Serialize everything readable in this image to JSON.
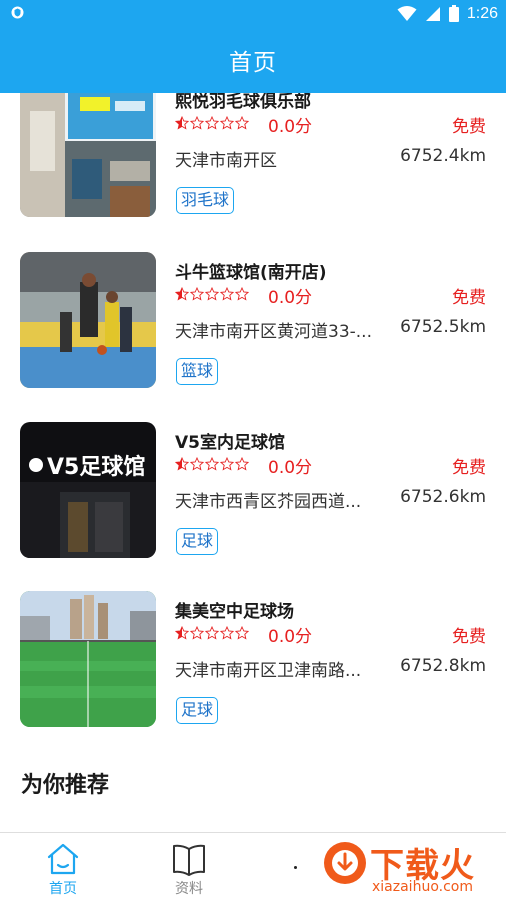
{
  "status_bar": {
    "time": "1:26"
  },
  "header": {
    "title": "首页"
  },
  "venues": [
    {
      "name": "熙悦羽毛球俱乐部",
      "rating": "0.0分",
      "stars_filled": 0.5,
      "price": "免费",
      "address": "天津市南开区",
      "distance": "6752.4km",
      "tag": "羽毛球"
    },
    {
      "name": "斗牛篮球馆(南开店)",
      "rating": "0.0分",
      "stars_filled": 0.5,
      "price": "免费",
      "address": "天津市南开区黄河道33-...",
      "distance": "6752.5km",
      "tag": "篮球"
    },
    {
      "name": "V5室内足球馆",
      "rating": "0.0分",
      "stars_filled": 0.5,
      "price": "免费",
      "address": "天津市西青区芥园西道...",
      "distance": "6752.6km",
      "tag": "足球",
      "thumb_sign": "V5足球馆"
    },
    {
      "name": "集美空中足球场",
      "rating": "0.0分",
      "stars_filled": 0.5,
      "price": "免费",
      "address": "天津市南开区卫津南路...",
      "distance": "6752.8km",
      "tag": "足球"
    }
  ],
  "recommend": {
    "title": "为你推荐"
  },
  "bottom_nav": {
    "items": [
      {
        "label": "首页",
        "icon": "home-icon",
        "active": true
      },
      {
        "label": "资料",
        "icon": "book-icon",
        "active": false
      }
    ]
  },
  "watermark": {
    "text_cn": "下载火",
    "text_en": "xiazaihuo.com"
  },
  "colors": {
    "accent": "#1da6f0",
    "price": "#e62020",
    "tag_border": "#1da6f0",
    "watermark": "#f05a1a"
  }
}
